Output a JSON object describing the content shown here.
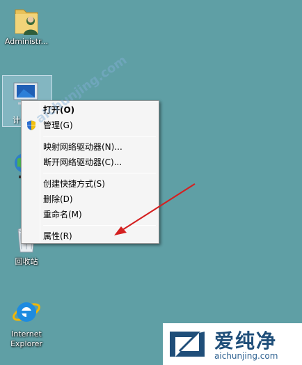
{
  "desktop": {
    "icons": [
      {
        "label": "Administr...",
        "icon": "user-folder-icon"
      },
      {
        "label": "计",
        "icon": "computer-icon"
      },
      {
        "label": "",
        "icon": "network-icon"
      },
      {
        "label": "回收站",
        "icon": "recycle-bin-icon"
      },
      {
        "label": "Internet\nExplorer",
        "icon": "ie-icon"
      }
    ]
  },
  "context_menu": {
    "items": [
      {
        "label": "打开(O)",
        "bold": true
      },
      {
        "label": "管理(G)",
        "icon": "uac-shield-icon"
      },
      {
        "label": "映射网络驱动器(N)..."
      },
      {
        "label": "断开网络驱动器(C)..."
      },
      {
        "label": "创建快捷方式(S)"
      },
      {
        "label": "删除(D)"
      },
      {
        "label": "重命名(M)"
      },
      {
        "label": "属性(R)"
      }
    ]
  },
  "watermark": {
    "title": "爱纯净",
    "url": "aichunjing.com",
    "overlay_text": "aichunjing.com"
  },
  "colors": {
    "desktop": "#5f9fa5",
    "menu_bg": "#f5f5f5",
    "arrow": "#d42020",
    "watermark_text": "#1f4e79"
  }
}
